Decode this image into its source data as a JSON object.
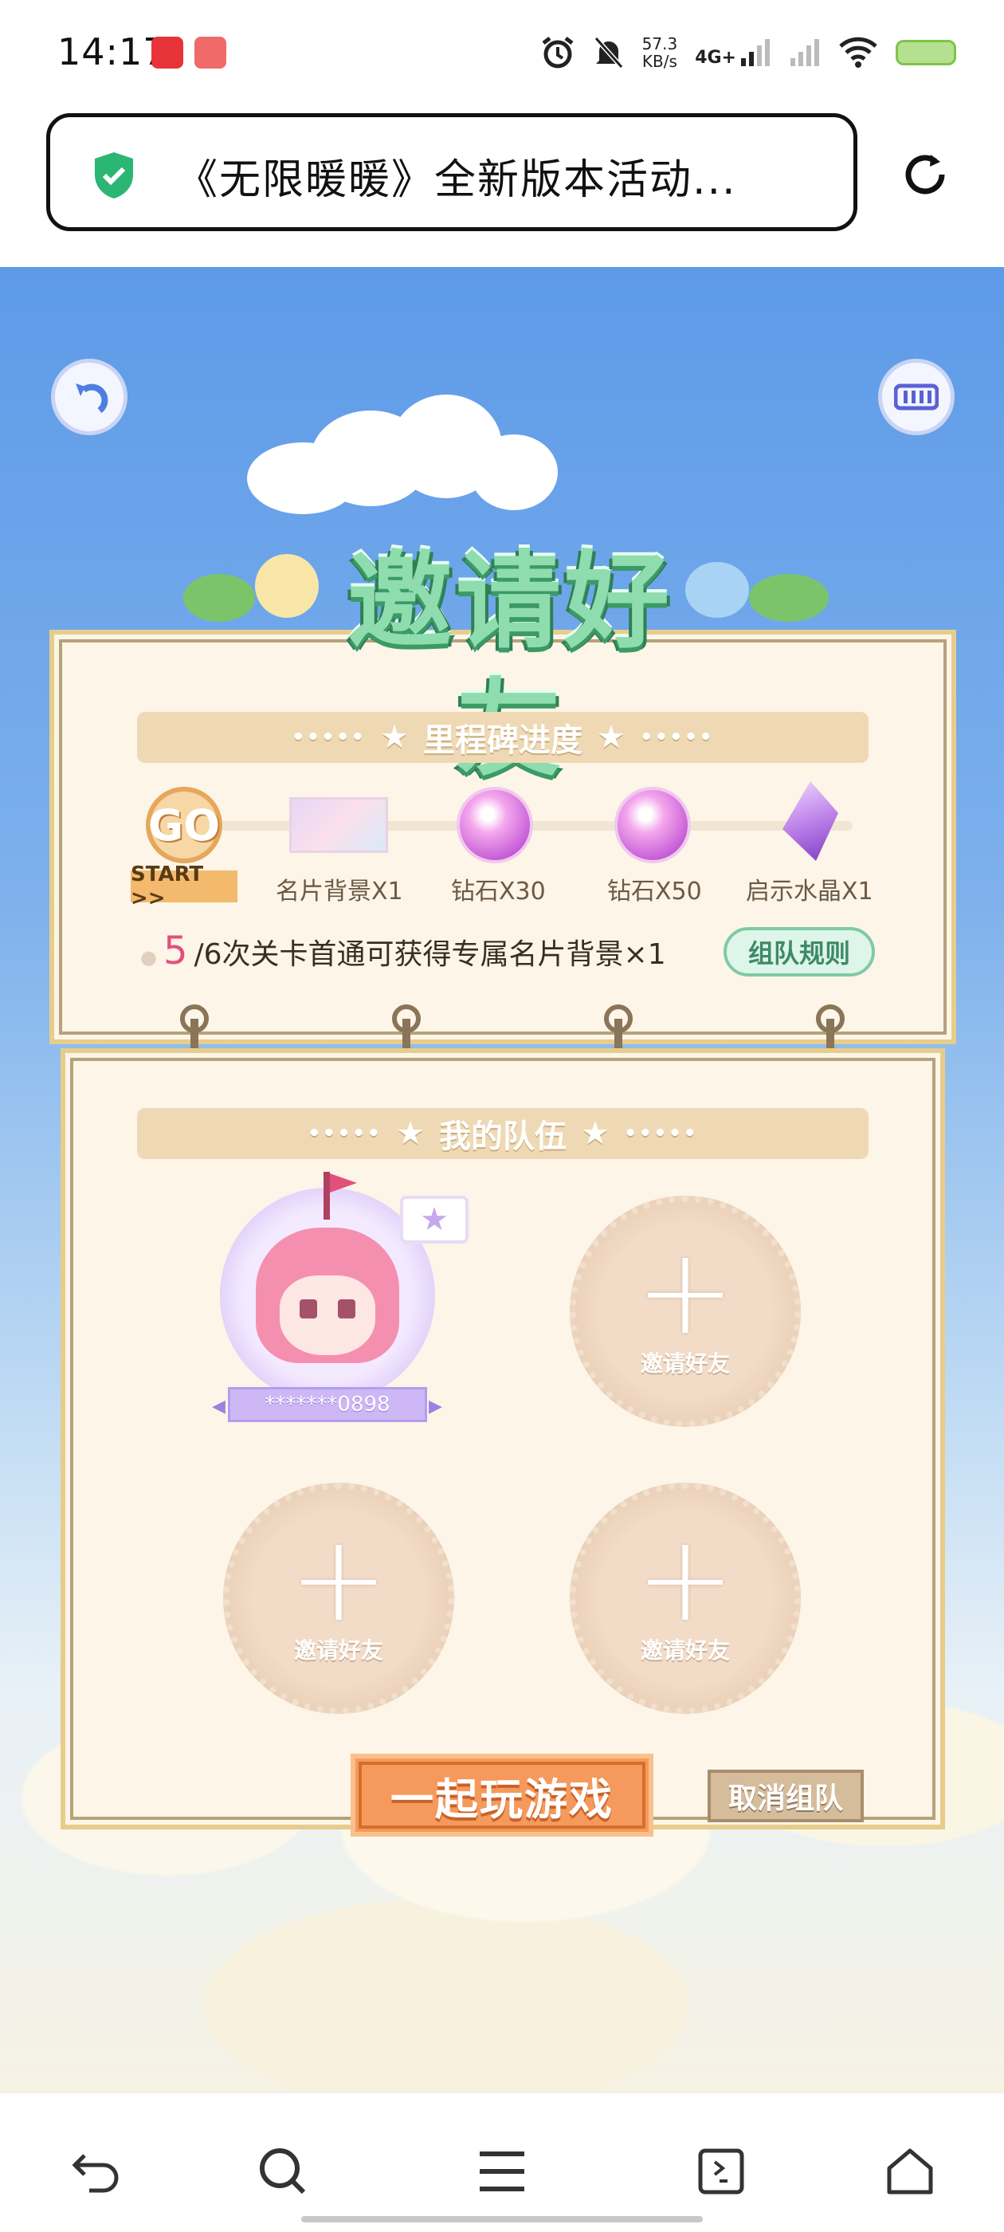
{
  "status_bar": {
    "time": "14:17",
    "speed_value": "57.3",
    "speed_unit": "KB/s",
    "network": "4G+",
    "battery_color": "#b5e08f"
  },
  "browser": {
    "page_title": "《无限暖暖》全新版本活动...",
    "secure_icon": "shield-check-icon",
    "reload_icon": "reload-icon"
  },
  "header_controls": {
    "back_icon": "back-arrow-icon",
    "music_icon": "sound-bars-icon"
  },
  "page": {
    "title": "邀请好友",
    "milestones": {
      "heading": "里程碑进度",
      "start_badge": "GO",
      "start_label": "START >>",
      "items": [
        {
          "label": "名片背景X1",
          "icon": "card-background-icon"
        },
        {
          "label": "钻石X30",
          "icon": "diamond-icon"
        },
        {
          "label": "钻石X50",
          "icon": "diamond-icon"
        },
        {
          "label": "启示水晶X1",
          "icon": "crystal-icon"
        }
      ],
      "progress_current": "5",
      "progress_text": "/6次关卡首通可获得专属名片背景×1",
      "rules_button": "组队规则"
    },
    "team": {
      "heading": "我的队伍",
      "member_name": "*******0898",
      "empty_slot_label": "邀请好友",
      "empty_slots": 3
    },
    "play_button": "一起玩游戏",
    "cancel_button": "取消组队"
  },
  "bottom_nav": {
    "items": [
      "back-icon",
      "search-icon",
      "menu-icon",
      "tabs-icon",
      "home-icon"
    ]
  },
  "colors": {
    "sky": "#5d9ae8",
    "title_green": "#8fdcae",
    "panel_bg": "#fcf5e8",
    "accent_pink": "#e2507d",
    "play_orange": "#f59a5c"
  }
}
